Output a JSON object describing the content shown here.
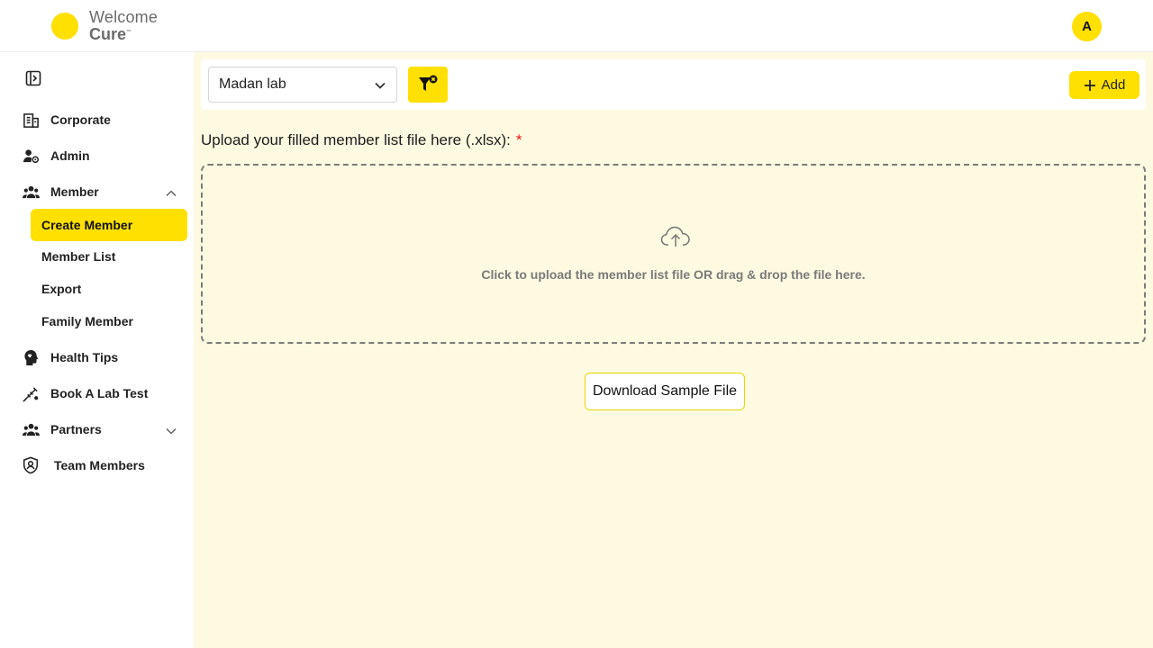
{
  "header": {
    "logo_line1": "Welcome",
    "logo_line2": "Cure",
    "logo_tm": "™",
    "avatar_initial": "A"
  },
  "sidebar": {
    "items": [
      {
        "label": "Corporate",
        "icon": "building-icon"
      },
      {
        "label": "Admin",
        "icon": "admin-gear-icon"
      },
      {
        "label": "Member",
        "icon": "group-icon",
        "expanded": true
      },
      {
        "label": "Health Tips",
        "icon": "head-heart-icon"
      },
      {
        "label": "Book A Lab Test",
        "icon": "microscope-icon"
      },
      {
        "label": "Partners",
        "icon": "group-icon",
        "expanded": false
      },
      {
        "label": "Team Members",
        "icon": "shield-user-icon"
      }
    ],
    "member_sub": [
      {
        "label": "Create Member",
        "active": true
      },
      {
        "label": "Member List"
      },
      {
        "label": "Export"
      },
      {
        "label": "Family Member"
      }
    ]
  },
  "toolbar": {
    "selected_lab": "Madan lab",
    "add_label": "Add"
  },
  "upload": {
    "label": "Upload your filled member list file here (.xlsx):",
    "required_mark": "*",
    "drop_text": "Click to upload the member list file OR drag & drop the file here.",
    "download_label": "Download Sample File"
  },
  "colors": {
    "accent": "#ffe000",
    "main_bg": "#fefae1",
    "required": "#ee1111"
  }
}
